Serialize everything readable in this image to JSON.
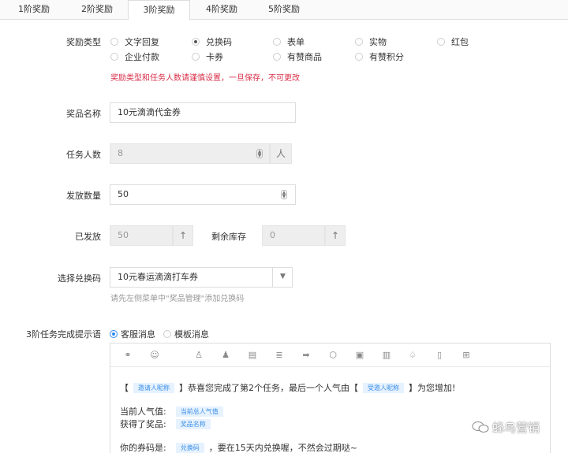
{
  "tabs": [
    "1阶奖励",
    "2阶奖励",
    "3阶奖励",
    "4阶奖励",
    "5阶奖励"
  ],
  "form": {
    "reward_type_label": "奖励类型",
    "reward_types": [
      "文字回复",
      "兑换码",
      "表单",
      "实物",
      "红包",
      "企业付款",
      "卡券",
      "有赞商品",
      "有赞积分"
    ],
    "selected_reward_type": "兑换码",
    "warning": "奖励类型和任务人数请谨慎设置，一旦保存，不可更改",
    "prize_name_label": "奖品名称",
    "prize_name_value": "10元滴滴代金券",
    "task_count_label": "任务人数",
    "task_count_value": "8",
    "task_count_unit": "人",
    "issue_count_label": "发放数量",
    "issue_count_value": "50",
    "issued_label": "已发放",
    "issued_value": "50",
    "remaining_label": "剩余库存",
    "remaining_value": "0",
    "select_code_label": "选择兑换码",
    "select_code_value": "10元春运滴滴打车券",
    "select_code_hint": "请先左侧菜单中\"奖品管理\"添加兑换码",
    "completion_msg_label": "3阶任务完成提示语",
    "msg_types": [
      "客服消息",
      "模板消息"
    ],
    "selected_msg_type": "客服消息"
  },
  "editor": {
    "toolbar_icons": [
      "link-icon",
      "emoji-icon",
      "user-icon",
      "users-icon",
      "document-icon",
      "database-icon",
      "arrow-icon",
      "cube-icon",
      "clipboard-icon",
      "chart-icon",
      "bell-icon",
      "frame-icon",
      "gift-icon"
    ],
    "line1_open": "【",
    "line1_tag1": "邀请人昵称",
    "line1_mid": "】恭喜您完成了第2个任务，最后一个人气由【",
    "line1_tag2": "受邀人昵称",
    "line1_end": "】为您增加!",
    "line2_text": "当前人气值:",
    "line2_tag": "当前总人气值",
    "line3_text": "获得了奖品:",
    "line3_tag": "奖品名称",
    "line4_text": "你的券码是:",
    "line4_tag": "兑换码",
    "line4_end": "，要在15天内兑换喔，不然会过期哒~"
  },
  "watermark": "蜂鸟营销"
}
